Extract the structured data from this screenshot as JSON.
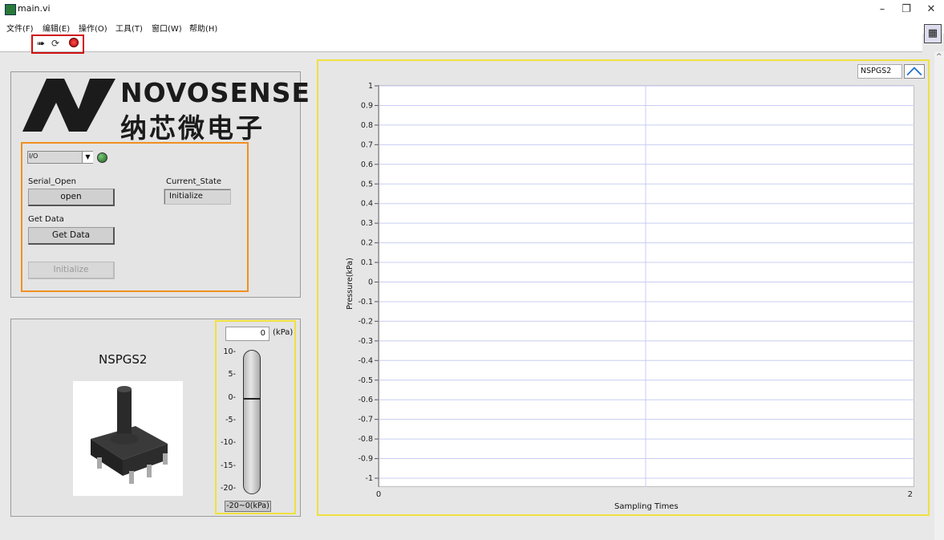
{
  "window": {
    "title": "main.vi",
    "minimize": "–",
    "restore": "❐",
    "close": "✕"
  },
  "menu": [
    "文件(F)",
    "编辑(E)",
    "操作(O)",
    "工具(T)",
    "窗口(W)",
    "帮助(H)"
  ],
  "toolbar": {
    "run_icon": "run-arrow-icon",
    "run_continuous_icon": "run-continuous-icon",
    "abort_icon": "abort-stop-icon"
  },
  "logo": {
    "en": "NOVOSENSE",
    "cn": "纳芯微电子"
  },
  "controls": {
    "serial_open_label": "Serial_Open",
    "open_button": "open",
    "current_state_label": "Current_State",
    "current_state_value": "Initialize",
    "get_data_label": "Get Data",
    "get_data_button": "Get Data",
    "initialize_button": "Initialize",
    "port_value": "",
    "port_arrow": "▼",
    "io_icon": "I/O"
  },
  "sensor": {
    "name": "NSPGS2"
  },
  "gauge": {
    "value": "0",
    "unit": "(kPa)",
    "range_label": "-20~0(kPa)",
    "ticks": [
      "10",
      "5",
      "0",
      "-5",
      "-10",
      "-15",
      "-20"
    ],
    "level": 0
  },
  "chart_data": {
    "type": "line",
    "legend": "NSPGS2",
    "xlabel": "Sampling Times",
    "ylabel": "Pressure(kPa)",
    "xlim": [
      0,
      2
    ],
    "ylim": [
      -1,
      1
    ],
    "x_ticks": [
      "0",
      "2"
    ],
    "y_ticks": [
      "1",
      "0.9",
      "0.8",
      "0.7",
      "0.6",
      "0.5",
      "0.4",
      "0.3",
      "0.2",
      "0.1",
      "0",
      "-0.1",
      "-0.2",
      "-0.3",
      "-0.4",
      "-0.5",
      "-0.6",
      "-0.7",
      "-0.8",
      "-0.9",
      "-1"
    ],
    "series": [
      {
        "name": "NSPGS2",
        "values": []
      }
    ],
    "grid": true,
    "colors": {
      "grid": "#c8cdf0",
      "line": "#1e6fd0"
    }
  }
}
